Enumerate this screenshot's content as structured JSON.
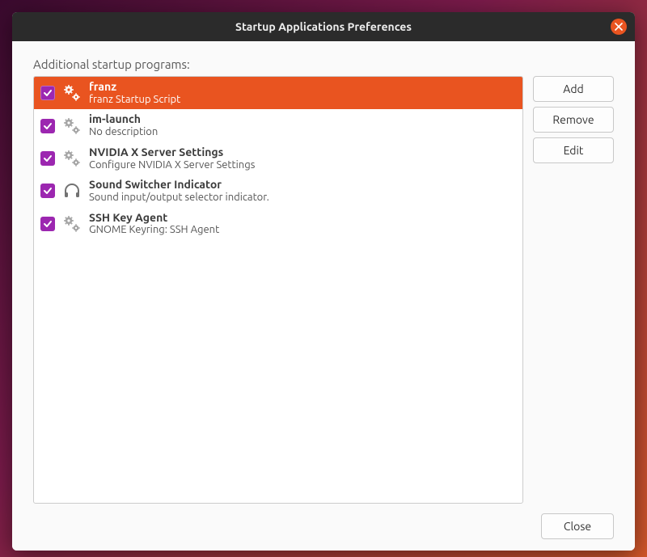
{
  "window": {
    "title": "Startup Applications Preferences"
  },
  "section_label": "Additional startup programs:",
  "buttons": {
    "add": "Add",
    "remove": "Remove",
    "edit": "Edit",
    "close": "Close"
  },
  "items": [
    {
      "name": "franz",
      "description": "franz Startup Script",
      "icon": "gears-icon",
      "checked": true,
      "selected": true
    },
    {
      "name": "im-launch",
      "description": "No description",
      "icon": "gears-icon",
      "checked": true,
      "selected": false
    },
    {
      "name": "NVIDIA X Server Settings",
      "description": "Configure NVIDIA X Server Settings",
      "icon": "gears-icon",
      "checked": true,
      "selected": false
    },
    {
      "name": "Sound Switcher Indicator",
      "description": "Sound input/output selector indicator.",
      "icon": "headphones-icon",
      "checked": true,
      "selected": false
    },
    {
      "name": "SSH Key Agent",
      "description": "GNOME Keyring: SSH Agent",
      "icon": "gears-icon",
      "checked": true,
      "selected": false
    }
  ]
}
